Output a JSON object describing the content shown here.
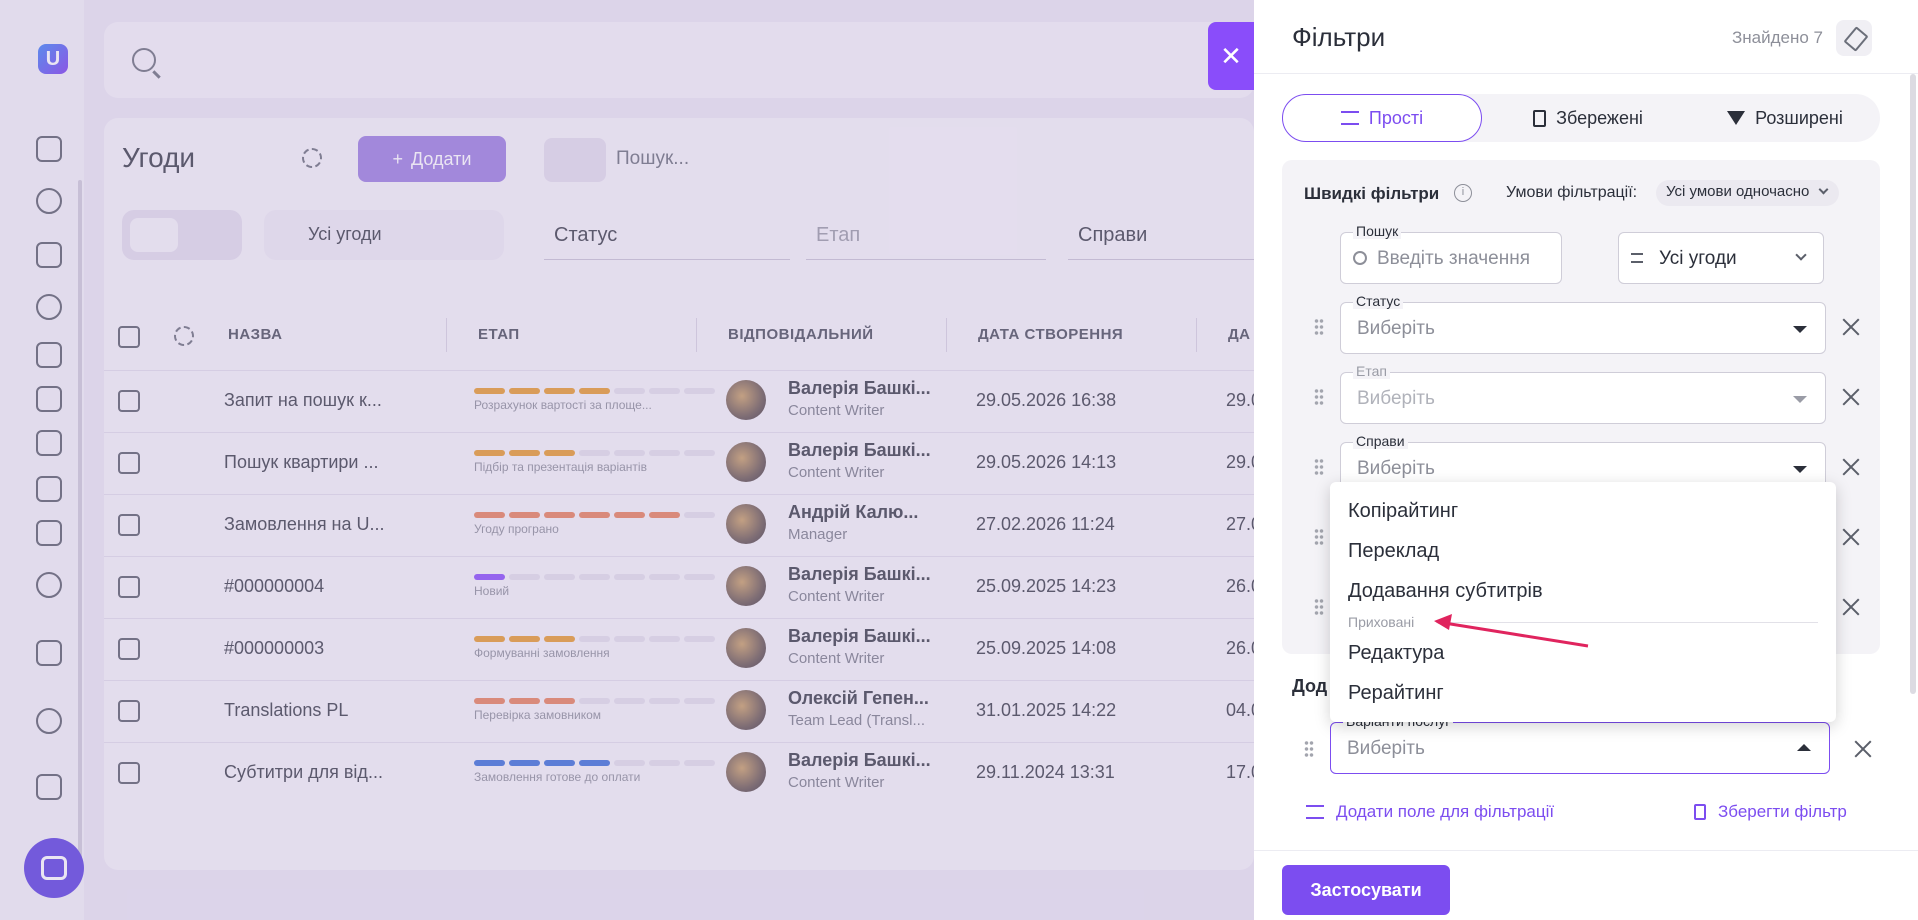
{
  "background": {
    "page_title": "Угоди",
    "add_button": "Додати",
    "search_placeholder": "Пошук...",
    "all_deals": "Усі угоди",
    "status_select": "Статус",
    "stage_select": "Етап",
    "cases_select": "Справи",
    "columns": [
      "НАЗВА",
      "ЕТАП",
      "ВІДПОВІДАЛЬНИЙ",
      "ДАТА СТВОРЕННЯ",
      "ДА"
    ],
    "rows": [
      {
        "name": "Запит на пошук к...",
        "stage": "Розрахунок вартості за площе...",
        "stage_color": "#e89a2b",
        "stage_filled": 4,
        "person": "Валерія Башкі...",
        "role": "Content Writer",
        "date": "29.05.2026 16:38",
        "date2": "29.0"
      },
      {
        "name": "Пошук квартири ...",
        "stage": "Підбір та презентація варіантів",
        "stage_color": "#e89a2b",
        "stage_filled": 3,
        "person": "Валерія Башкі...",
        "role": "Content Writer",
        "date": "29.05.2026 14:13",
        "date2": "29.0"
      },
      {
        "name": "Замовлення на U...",
        "stage": "Угоду програно",
        "stage_color": "#e8825a",
        "stage_filled": 6,
        "person": "Андрій Калю...",
        "role": "Manager",
        "date": "27.02.2026 11:24",
        "date2": "27.0"
      },
      {
        "name": "#000000004",
        "stage": "Новий",
        "stage_color": "#8a4dfa",
        "stage_filled": 1,
        "person": "Валерія Башкі...",
        "role": "Content Writer",
        "date": "25.09.2025 14:23",
        "date2": "26.0"
      },
      {
        "name": "#000000003",
        "stage": "Формуванні замовлення",
        "stage_color": "#e89a2b",
        "stage_filled": 3,
        "person": "Валерія Башкі...",
        "role": "Content Writer",
        "date": "25.09.2025 14:08",
        "date2": "26.0"
      },
      {
        "name": "Translations PL",
        "stage": "Перевірка замовником",
        "stage_color": "#e8825a",
        "stage_filled": 3,
        "person": "Олексій Гепен...",
        "role": "Team Lead (Transl...",
        "date": "31.01.2025 14:22",
        "date2": "04.0"
      },
      {
        "name": "Субтитри для від...",
        "stage": "Замовлення готове до оплати",
        "stage_color": "#3b6fd8",
        "stage_filled": 4,
        "person": "Валерія Башкі...",
        "role": "Content Writer",
        "date": "29.11.2024 13:31",
        "date2": "17.0"
      }
    ]
  },
  "panel": {
    "title": "Фільтри",
    "found": "Знайдено 7",
    "tabs": [
      "Прості",
      "Збережені",
      "Розширені"
    ],
    "quick_title": "Швидкі фільтри",
    "conditions_label": "Умови фільтрації:",
    "conditions_value": "Усі умови одночасно",
    "search": {
      "label": "Пошук",
      "placeholder": "Введіть значення"
    },
    "deals_select": "Усі угоди",
    "status": {
      "label": "Статус",
      "value": "Виберіть"
    },
    "stage": {
      "label": "Етап",
      "value": "Виберіть"
    },
    "cases": {
      "label": "Справи",
      "value": "Виберіть"
    },
    "additional_label": "Дод",
    "services": {
      "label": "Варіанти послуг",
      "value": "Виберіть"
    },
    "add_field": "Додати поле для фільтрації",
    "save_filter": "Зберегти фільтр",
    "apply": "Застосувати"
  },
  "dropdown": {
    "items": [
      "Копірайтинг",
      "Переклад",
      "Додавання субтитрів"
    ],
    "group_label": "Приховані",
    "hidden_items": [
      "Редактура",
      "Рерайтинг"
    ]
  },
  "colors": {
    "accent": "#7c4df0",
    "close_tab": "#8a4dfa",
    "arrow": "#e0245e"
  }
}
